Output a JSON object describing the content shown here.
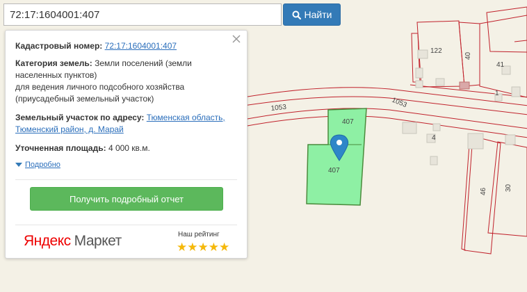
{
  "search": {
    "value": "72:17:1604001:407",
    "button_label": "Найти"
  },
  "info": {
    "cadastral_label": "Кадастровый номер:",
    "cadastral_number": "72:17:1604001:407",
    "category_label": "Категория земель:",
    "category_value_1": "Земли поселений (земли",
    "category_value_2": "населенных пунктов)",
    "category_value_3": "для ведения личного подсобного хозяйства",
    "category_value_4": "(приусадебный земельный участок)",
    "address_label": "Земельный участок по адресу:",
    "address_link_1": "Тюменская область,",
    "address_link_2": "Тюменский район, д. Марай",
    "area_label": "Уточненная площадь:",
    "area_value": "4 000 кв.м.",
    "details_link": "Подробно",
    "report_button": "Получить подробный отчет",
    "market_logo_1": "Яндекс",
    "market_logo_2": "Маркет",
    "rating_label": "Наш рейтинг",
    "rating_stars": "★★★★★",
    "rating_value": 5
  },
  "map_labels": {
    "parcel_top": "407",
    "parcel_main": "407",
    "road_left": "1053",
    "road_right": "1053",
    "lot_122": "122",
    "lot_40": "40",
    "lot_41": "41",
    "lot_1": "1",
    "lot_4": "4",
    "lot_46": "46",
    "lot_30": "30"
  },
  "colors": {
    "parcel_fill": "#8ef0a4",
    "parcel_stroke": "#4a8a3c",
    "boundary": "#c0202a",
    "marker": "#2e86c8",
    "report_button": "#5cb85c",
    "search_button": "#337ab7"
  },
  "icons": {
    "search": "search-icon",
    "close": "close-icon",
    "marker": "map-marker-icon",
    "details": "triangle-down-icon",
    "rating": "star-icon"
  }
}
